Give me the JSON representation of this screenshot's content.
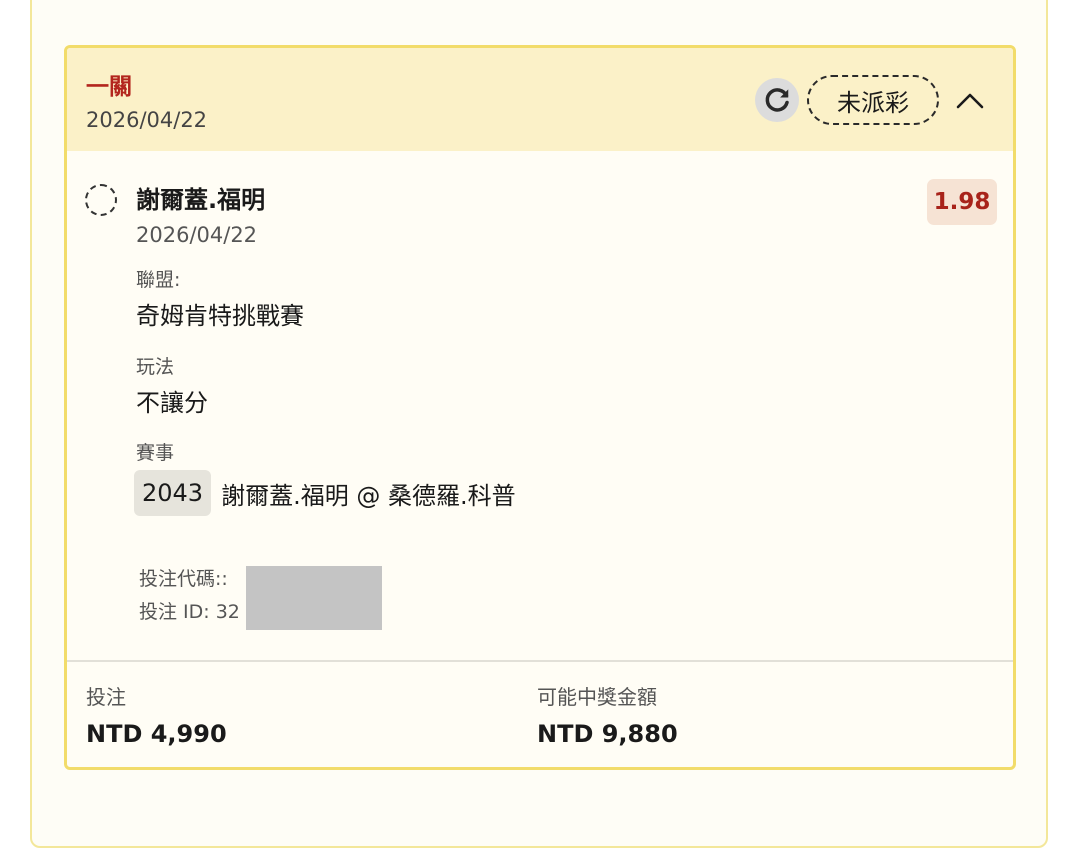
{
  "bet": {
    "type_label": "一關",
    "date": "2026/04/22",
    "status": "未派彩",
    "selection": {
      "name": "謝爾蓋.福明",
      "date": "2026/04/22",
      "odds": "1.98",
      "league_label": "聯盟:",
      "league": "奇姆肯特挑戰賽",
      "market_label": "玩法",
      "market": "不讓分",
      "event_label": "賽事",
      "event_id": "2043",
      "event_name": "謝爾蓋.福明 @ 桑德羅.科普"
    },
    "bet_code_label": "投注代碼::",
    "bet_id_label": "投注 ID: 32",
    "stake_label": "投注",
    "stake": "NTD 4,990",
    "potential_label": "可能中獎金額",
    "potential": "NTD 9,880"
  },
  "colors": {
    "header_bg": "#fbf1c8",
    "card_border": "#f2dc6a",
    "accent_red": "#b3261e",
    "odds_bg": "#f6e3d4"
  },
  "icons": {
    "refresh": "refresh-icon",
    "collapse": "chevron-up-icon",
    "selection_status": "pending-circle-icon"
  }
}
